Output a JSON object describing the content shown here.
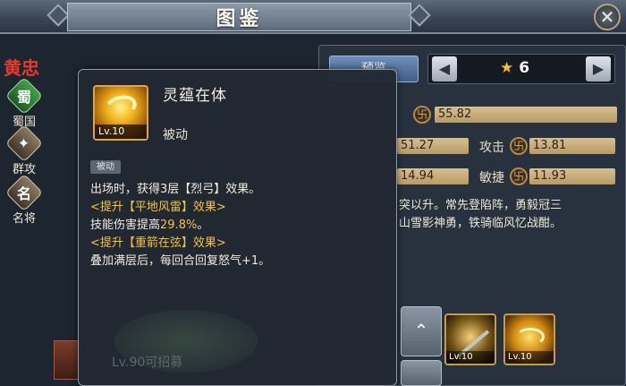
{
  "header": {
    "title": "图鉴",
    "close_symbol": "✕"
  },
  "hero": {
    "name": "黄忠"
  },
  "sidebar": {
    "items": [
      {
        "badge": "蜀",
        "label": "蜀国"
      },
      {
        "badge": "✦",
        "label": "群攻"
      },
      {
        "badge": "名",
        "label": "名将"
      }
    ]
  },
  "panel": {
    "preview_label": "预览",
    "star_level": "6",
    "stats": [
      {
        "label": "攻击",
        "value": "13.81"
      },
      {
        "label": "敏捷",
        "value": "11.93"
      }
    ],
    "stat_values_partial": [
      "55.82",
      "51.27",
      "14.94"
    ],
    "description_lines": [
      "突以升。常先登陷阵，勇毅冠三",
      "山雪影神勇，铁骑临风忆战酣。"
    ],
    "skills": [
      {
        "level": "Lv.10",
        "icon": "spear-icon"
      },
      {
        "level": "Lv.10",
        "icon": "golden-swirl-icon"
      }
    ]
  },
  "tooltip": {
    "skill_name": "灵蕴在体",
    "skill_level": "Lv.10",
    "skill_type": "被动",
    "tag": "被动",
    "lines": [
      {
        "parts": [
          {
            "text": "出场时，获得3层【烈弓】效果。",
            "style": "white"
          }
        ]
      },
      {
        "parts": [
          {
            "text": "<提升【平地风雷】效果>",
            "style": "gold"
          }
        ]
      },
      {
        "parts": [
          {
            "text": "技能伤害提高",
            "style": "white"
          },
          {
            "text": "29.8%",
            "style": "gold"
          },
          {
            "text": "。",
            "style": "white"
          }
        ]
      },
      {
        "parts": [
          {
            "text": "<提升【重箭在弦】效果>",
            "style": "gold"
          }
        ]
      },
      {
        "parts": [
          {
            "text": "叠加满层后，每回合回复怒气+1。",
            "style": "white"
          }
        ]
      }
    ],
    "recruit_text": "Lv.90可招募"
  },
  "colors": {
    "accent_gold": "#f3c33a",
    "hero_name": "#e23c2c",
    "panel_bg": "#27323e"
  }
}
